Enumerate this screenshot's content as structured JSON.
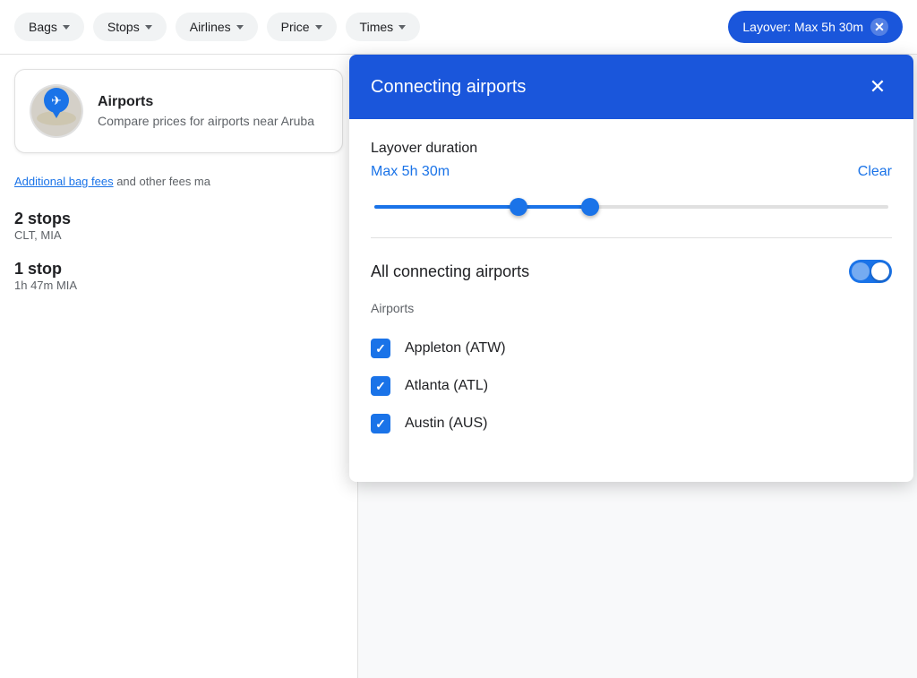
{
  "filterBar": {
    "pills": [
      {
        "id": "bags",
        "label": "Bags"
      },
      {
        "id": "stops",
        "label": "Stops"
      },
      {
        "id": "airlines",
        "label": "Airlines"
      },
      {
        "id": "price",
        "label": "Price"
      },
      {
        "id": "times",
        "label": "Times"
      }
    ],
    "layoverPill": {
      "label": "Layover: Max 5h 30m",
      "closeLabel": "✕"
    }
  },
  "airportCard": {
    "title": "Airports",
    "description": "Compare prices for airports near Aruba"
  },
  "feesText": {
    "linkText": "Additional bag fees",
    "rest": " and other fees ma"
  },
  "flightEntries": [
    {
      "stops": "2 stops",
      "airports": "CLT, MIA",
      "duration": ""
    },
    {
      "stops": "1 stop",
      "airports": "",
      "duration": "1h 47m MIA"
    }
  ],
  "modal": {
    "title": "Connecting airports",
    "closeLabel": "✕",
    "layover": {
      "label": "Layover duration",
      "value": "Max 5h 30m",
      "clearLabel": "Clear"
    },
    "slider": {
      "leftThumbPercent": 28,
      "rightThumbPercent": 42
    },
    "allConnecting": {
      "label": "All connecting airports",
      "toggled": true
    },
    "airportsLabel": "Airports",
    "airports": [
      {
        "code": "ATW",
        "name": "Appleton (ATW)",
        "checked": true
      },
      {
        "code": "ATL",
        "name": "Atlanta (ATL)",
        "checked": true
      },
      {
        "code": "AUS",
        "name": "Austin (AUS)",
        "checked": true
      }
    ]
  }
}
